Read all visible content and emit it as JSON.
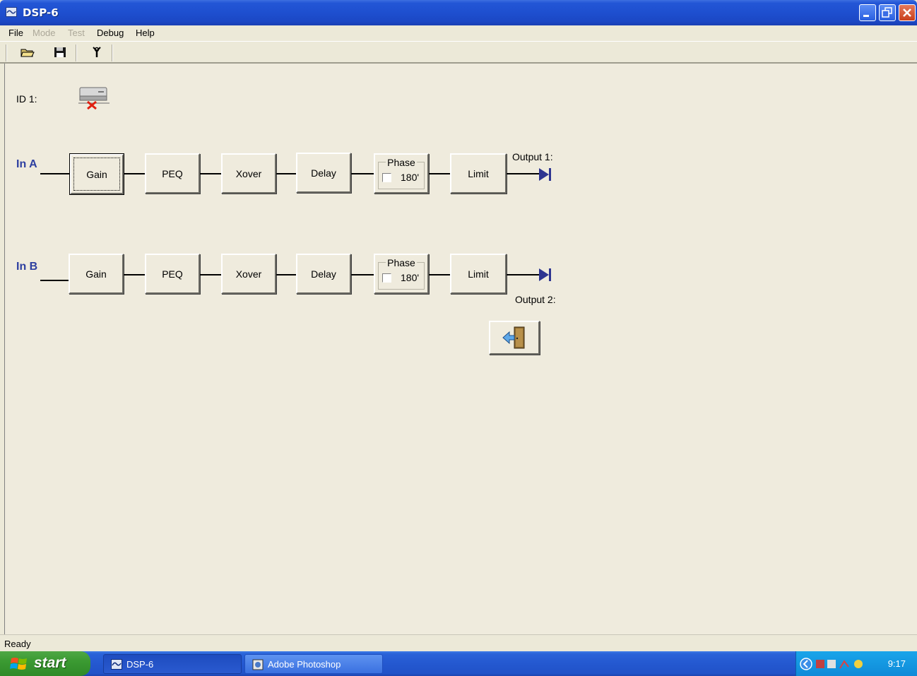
{
  "window": {
    "title": "DSP-6"
  },
  "menu": [
    {
      "label": "File",
      "enabled": true
    },
    {
      "label": "Mode",
      "enabled": false
    },
    {
      "label": "Test",
      "enabled": false
    },
    {
      "label": "Debug",
      "enabled": true
    },
    {
      "label": "Help",
      "enabled": true
    }
  ],
  "toolbar": {
    "icons": [
      "open-folder-icon",
      "save-disk-icon",
      "tools-icon"
    ]
  },
  "device": {
    "id_label": "ID 1:",
    "status_icon": "device-disconnected-icon"
  },
  "channel_a": {
    "label": "In A",
    "buttons": {
      "gain": "Gain",
      "peq": "PEQ",
      "xover": "Xover",
      "delay": "Delay",
      "limit": "Limit"
    },
    "phase": {
      "title": "Phase",
      "value": "180'",
      "checked": false
    },
    "output_label": "Output 1:"
  },
  "channel_b": {
    "label": "In B",
    "buttons": {
      "gain": "Gain",
      "peq": "PEQ",
      "xover": "Xover",
      "delay": "Delay",
      "limit": "Limit"
    },
    "phase": {
      "title": "Phase",
      "value": "180'",
      "checked": false
    },
    "output_label": "Output 2:"
  },
  "exit_button": {
    "icon": "exit-door-icon"
  },
  "statusbar": {
    "text": "Ready"
  },
  "taskbar": {
    "start_label": "start",
    "tasks": [
      {
        "label": "DSP-6",
        "active": true
      },
      {
        "label": "Adobe Photoshop",
        "active": false
      }
    ],
    "clock": "9:17"
  },
  "colors": {
    "titlebar": "#1e4fcf",
    "channel_label": "#2d3fa0",
    "output_arrow": "#2d3490",
    "client_bg": "#EFEBDD"
  }
}
